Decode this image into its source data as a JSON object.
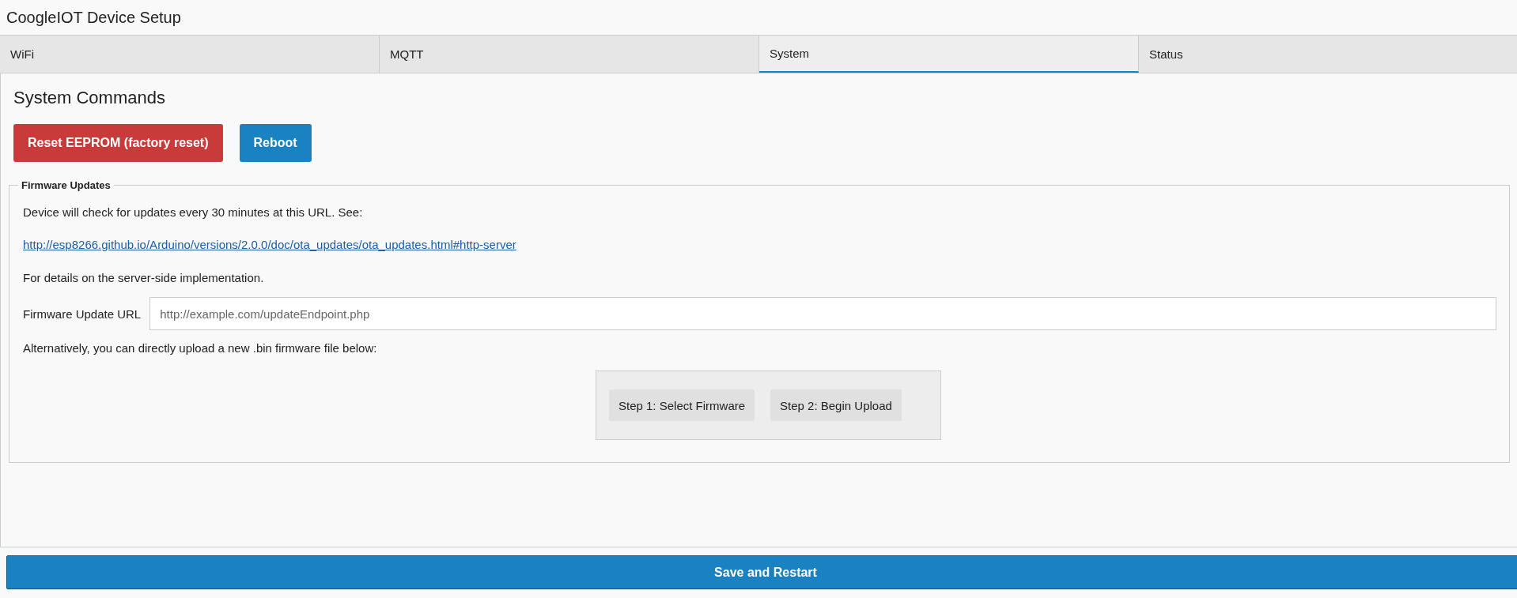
{
  "header": {
    "title": "CoogleIOT Device Setup"
  },
  "tabs": [
    {
      "label": "WiFi",
      "selected": false
    },
    {
      "label": "MQTT",
      "selected": false
    },
    {
      "label": "System",
      "selected": true
    },
    {
      "label": "Status",
      "selected": false
    }
  ],
  "system_commands": {
    "heading": "System Commands",
    "buttons": [
      {
        "label": "Reset EEPROM (factory reset)",
        "kind": "danger"
      },
      {
        "label": "Reboot",
        "kind": "primary"
      }
    ]
  },
  "firmware_updates": {
    "legend": "Firmware Updates",
    "intro": "Device will check for updates every 30 minutes at this URL. See:",
    "link": "http://esp8266.github.io/Arduino/versions/2.0.0/doc/ota_updates/ota_updates.html#http-server",
    "details": "For details on the server-side implementation.",
    "url_label": "Firmware Update URL",
    "url_placeholder": "http://example.com/updateEndpoint.php",
    "alternative": "Alternatively, you can directly upload a new .bin firmware file below:",
    "upload_buttons": [
      "Step 1: Select Firmware",
      "Step 2: Begin Upload"
    ]
  },
  "save_button": "Save and Restart"
}
